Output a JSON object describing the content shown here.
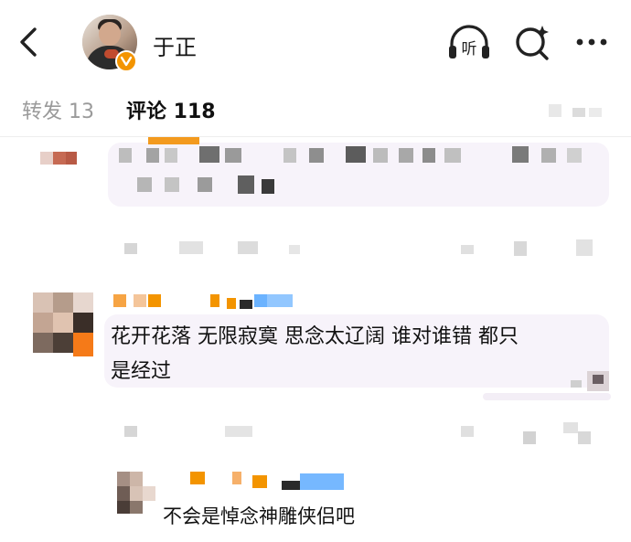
{
  "header": {
    "username": "于正",
    "icons": [
      "back-icon",
      "avatar",
      "verified-badge-icon",
      "listen-icon",
      "search-icon",
      "more-icon"
    ],
    "listen_glyph": "听"
  },
  "tabs": {
    "repost_label": "转发 13",
    "comment_label": "评论 118"
  },
  "comments": [
    {
      "id": "c1",
      "text": "",
      "meta": ""
    },
    {
      "id": "c2",
      "text_line1": "花开花落 无限寂寞 思念太辽阔 谁对谁错 都只",
      "text_line2": "是经过"
    },
    {
      "id": "c3",
      "text": "不会是悼念神雕侠侣吧"
    }
  ],
  "colors": {
    "accent_orange": "#f39400",
    "bubble_bg": "#f7f3fa",
    "text_primary": "#111111",
    "text_muted": "#9a9a9a"
  }
}
